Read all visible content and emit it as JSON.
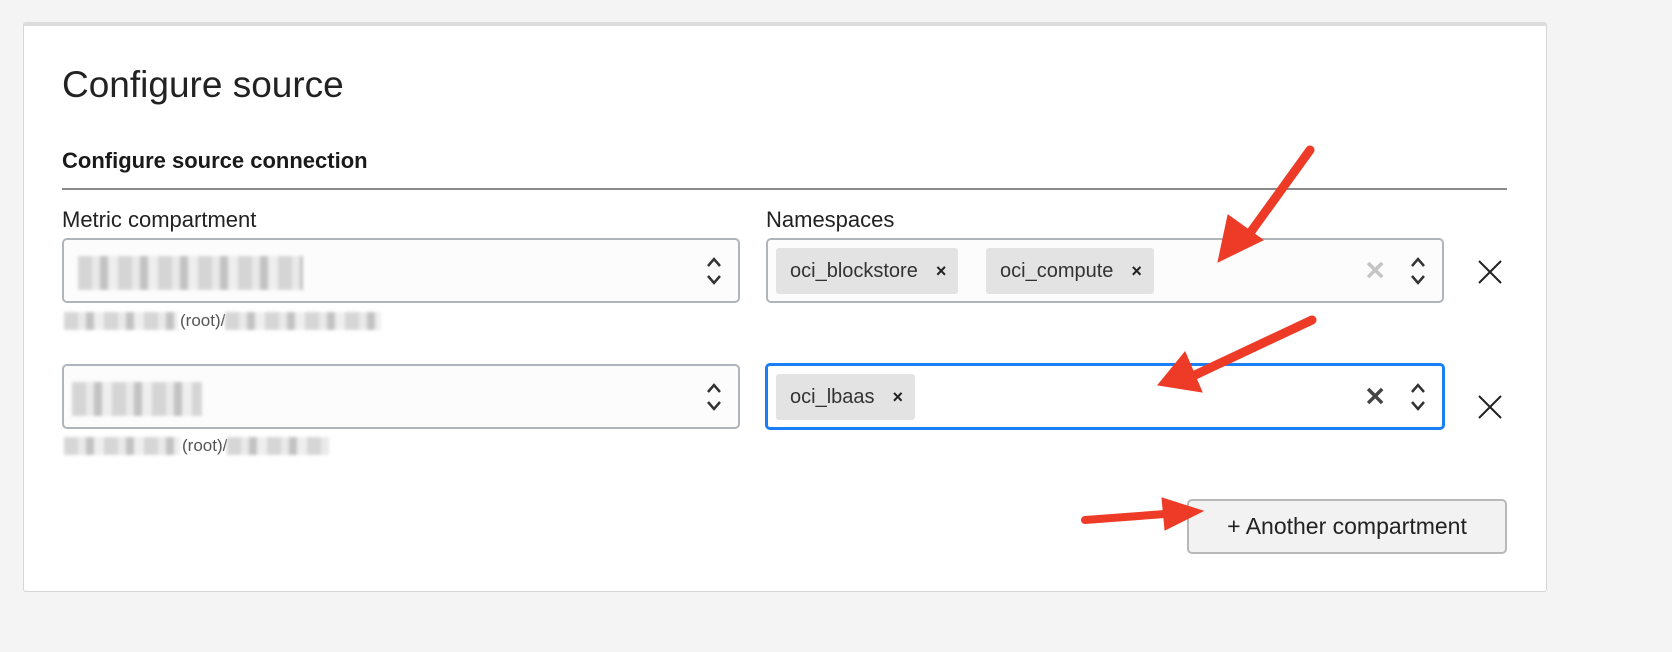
{
  "title": "Configure source",
  "section": "Configure source connection",
  "labels": {
    "compartment": "Metric compartment",
    "namespaces": "Namespaces"
  },
  "rows": [
    {
      "compartment_path_visible": "(root)/",
      "namespaces": [
        "oci_blockstore",
        "oci_compute"
      ],
      "chip_remove": "×",
      "focused": false
    },
    {
      "compartment_path_visible": "(root)/",
      "namespaces": [
        "oci_lbaas"
      ],
      "chip_remove": "×",
      "focused": true
    }
  ],
  "add_button": "+ Another compartment",
  "colors": {
    "accent": "#1a7ef5",
    "annotation": "#ee3b27"
  }
}
